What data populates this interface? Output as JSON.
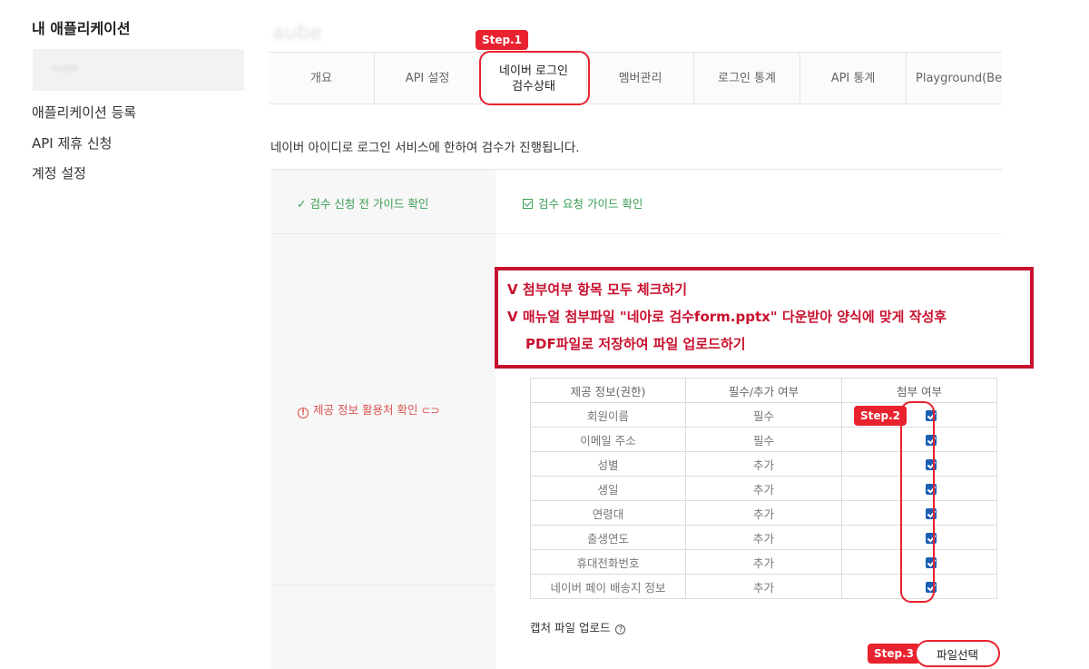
{
  "sidebar": {
    "title": "내 애플리케이션",
    "app_name": "aube",
    "items": [
      {
        "label": "애플리케이션 등록"
      },
      {
        "label": "API 제휴 신청"
      },
      {
        "label": "계정 설정"
      }
    ]
  },
  "header": {
    "app_name": "aube"
  },
  "tabs": [
    {
      "label": "개요"
    },
    {
      "label": "API 설정"
    },
    {
      "label": "네이버 로그인\n검수상태"
    },
    {
      "label": "멤버관리"
    },
    {
      "label": "로그인 통계"
    },
    {
      "label": "API 통계"
    },
    {
      "label": "Playground(Be"
    }
  ],
  "description": "네이버 아이디로 로그인 서비스에 한하여 검수가 진행됩니다.",
  "review": {
    "guide_check_label": "✓ 검수 신청 전 가이드 확인",
    "guide_request_label": "검수 요청 가이드 확인",
    "info_usage_label": "제공 정보 활용처 확인"
  },
  "annotation": {
    "line1": "V 첨부여부 항목 모두 체크하기",
    "line2": "V 매뉴얼 첨부파일 \"네아로 검수form.pptx\" 다운받아 양식에 맞게 작성후",
    "line3": "PDF파일로 저장하여 파일 업로드하기"
  },
  "table": {
    "headers": [
      "제공 정보(권한)",
      "필수/추가 여부",
      "첨부 여부"
    ],
    "rows": [
      {
        "name": "회원이름",
        "type": "필수",
        "checked": true
      },
      {
        "name": "이메일 주소",
        "type": "필수",
        "checked": true
      },
      {
        "name": "성별",
        "type": "추가",
        "checked": true
      },
      {
        "name": "생일",
        "type": "추가",
        "checked": true
      },
      {
        "name": "연령대",
        "type": "추가",
        "checked": true
      },
      {
        "name": "출생연도",
        "type": "추가",
        "checked": true
      },
      {
        "name": "휴대전화번호",
        "type": "추가",
        "checked": true
      },
      {
        "name": "네이버 페이 배송지 정보",
        "type": "추가",
        "checked": true
      }
    ]
  },
  "upload": {
    "label": "캡처 파일 업로드",
    "button": "파일선택"
  },
  "steps": {
    "step1": "Step.1",
    "step2": "Step.2",
    "step3": "Step.3"
  },
  "colors": {
    "accent_red": "#e8222e",
    "annotation_red": "#c8102e",
    "green": "#3a9d51",
    "checkbox_blue": "#1a5fb4"
  }
}
